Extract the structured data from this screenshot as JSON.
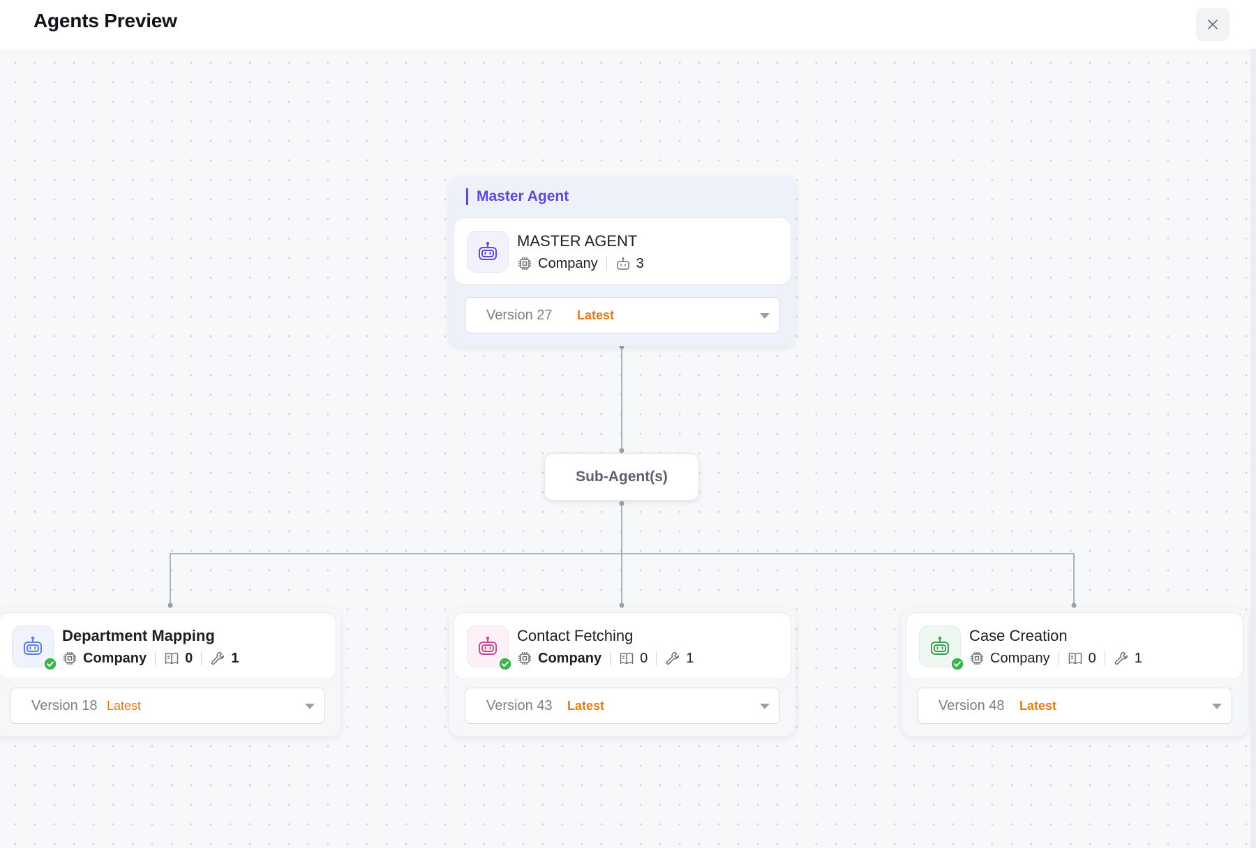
{
  "header": {
    "title": "Agents Preview"
  },
  "master": {
    "group_label": "Master Agent",
    "agent": {
      "name": "MASTER AGENT",
      "scope": "Company",
      "sub_agent_count": "3"
    },
    "version": {
      "label": "Version 27",
      "badge": "Latest"
    }
  },
  "sub_agents_node": {
    "label": "Sub-Agent(s)"
  },
  "sub_agents": [
    {
      "name": "Department Mapping",
      "scope": "Company",
      "knowledge_count": "0",
      "tools_count": "1",
      "version": {
        "label": "Version 18",
        "badge": "Latest"
      },
      "accent": "#5b7fd6"
    },
    {
      "name": "Contact Fetching",
      "scope": "Company",
      "knowledge_count": "0",
      "tools_count": "1",
      "version": {
        "label": "Version 43",
        "badge": "Latest"
      },
      "accent": "#c8479a"
    },
    {
      "name": "Case Creation",
      "scope": "Company",
      "knowledge_count": "0",
      "tools_count": "1",
      "version": {
        "label": "Version 48",
        "badge": "Latest"
      },
      "accent": "#3f9e55"
    }
  ],
  "colors": {
    "master_accent": "#5a4bd6",
    "latest": "#e07c1a",
    "verified": "#3ab54a"
  }
}
